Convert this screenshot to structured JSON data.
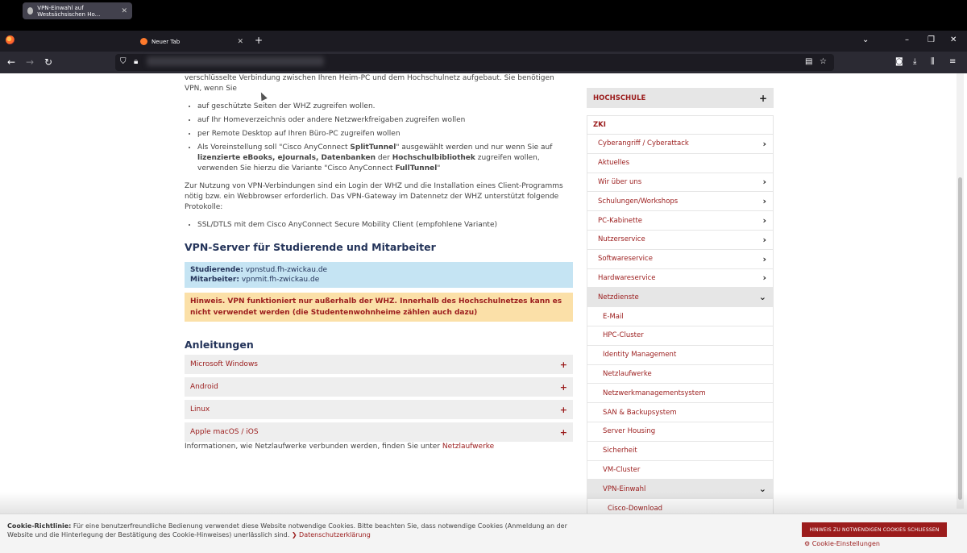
{
  "browser": {
    "tabs": [
      {
        "label": "VPN-Einwahl auf Westsächsischen Ho...",
        "active": true
      },
      {
        "label": "Neuer Tab",
        "active": false
      }
    ],
    "new_tab": "+",
    "window_controls": {
      "minimize": "–",
      "maximize": "❐",
      "close": "✕",
      "list": "⌄"
    },
    "nav": {
      "back": "←",
      "forward": "→",
      "reload": "↻"
    }
  },
  "main": {
    "intro": "verschlüsselte Verbindung zwischen Ihren Heim-PC und dem Hochschulnetz aufgebaut. Sie benötigen VPN, wenn Sie",
    "bullets": [
      "auf geschützte Seiten der WHZ zugreifen wollen.",
      "auf Ihr Homeverzeichnis oder andere Netzwerkfreigaben zugreifen wollen",
      "per Remote Desktop auf Ihren Büro-PC zugreifen wollen"
    ],
    "bullet4": {
      "t1": "Als Voreinstellung soll \"Cisco AnyConnect ",
      "b1": "SplitTunnel",
      "t2": "\" ausgewählt werden und nur wenn Sie auf ",
      "b2": "lizenzierte eBooks, eJournals, Datenbanken",
      "t3": " der ",
      "b3": "Hochschulbibliothek",
      "t4": " zugreifen wollen, verwenden Sie hierzu die Variante \"Cisco AnyConnect ",
      "b4": "FullTunnel",
      "t5": "\""
    },
    "usage": "Zur Nutzung von VPN-Verbindungen sind ein Login der WHZ und die Installation eines Client-Programms nötig bzw. ein Webbrowser erforderlich. Das VPN-Gateway im Datennetz der WHZ unterstützt folgende Protokolle:",
    "protocols": [
      "SSL/DTLS mit dem Cisco AnyConnect Secure Mobility Client (empfohlene Variante)"
    ],
    "server_heading": "VPN-Server für Studierende und Mitarbeiter",
    "servers": [
      {
        "label": "Studierende:",
        "host": "vpnstud.fh-zwickau.de"
      },
      {
        "label": "Mitarbeiter:",
        "host": "vpnmit.fh-zwickau.de"
      }
    ],
    "warning": "Hinweis. VPN funktioniert nur außerhalb der WHZ. Innerhalb des Hochschulnetzes kann es nicht verwendet werden (die Studentenwohnheime zählen auch dazu)",
    "guides_heading": "Anleitungen",
    "guides": [
      "Microsoft Windows",
      "Android",
      "Linux",
      "Apple macOS / iOS"
    ],
    "guide_icon": "+",
    "info_text": "Informationen, wie Netzlaufwerke verbunden werden, finden Sie unter ",
    "info_link": "Netzlaufwerke"
  },
  "sidebar": {
    "head": "HOCHSCHULE",
    "head_icon": "+",
    "zki": "ZKI",
    "items": [
      {
        "label": "Cyberangriff / Cyberattack",
        "arrow": "›"
      },
      {
        "label": "Aktuelles",
        "arrow": ""
      },
      {
        "label": "Wir über uns",
        "arrow": "›"
      },
      {
        "label": "Schulungen/Workshops",
        "arrow": "›"
      },
      {
        "label": "PC-Kabinette",
        "arrow": "›"
      },
      {
        "label": "Nutzerservice",
        "arrow": "›"
      },
      {
        "label": "Softwareservice",
        "arrow": "›"
      },
      {
        "label": "Hardwareservice",
        "arrow": "›"
      },
      {
        "label": "Netzdienste",
        "arrow": "⌄"
      }
    ],
    "netz_items": [
      {
        "label": "E-Mail",
        "arrow": ""
      },
      {
        "label": "HPC-Cluster",
        "arrow": ""
      },
      {
        "label": "Identity Management",
        "arrow": ""
      },
      {
        "label": "Netzlaufwerke",
        "arrow": ""
      },
      {
        "label": "Netzwerkmanagementsystem",
        "arrow": ""
      },
      {
        "label": "SAN & Backupsystem",
        "arrow": ""
      },
      {
        "label": "Server Housing",
        "arrow": ""
      },
      {
        "label": "Sicherheit",
        "arrow": ""
      },
      {
        "label": "VM-Cluster",
        "arrow": ""
      },
      {
        "label": "VPN-Einwahl",
        "arrow": "⌄"
      }
    ],
    "vpn_items": [
      {
        "label": "Cisco-Download"
      }
    ]
  },
  "cookie": {
    "title": "Cookie-Richtlinie:",
    "text": " Für eine benutzerfreundliche Bedienung verwendet diese Website notwendige Cookies. Bitte beachten Sie, dass notwendige Cookies (Anmeldung an der Website und die Hinterlegung der Bestätigung des Cookie-Hinweises) unerlässlich sind. ",
    "link": "❯ Datenschutzerklärung",
    "button": "HINWEIS ZU NOTWENDIGEN COOKIES SCHLIESSEN",
    "settings": "⚙ Cookie-Einstellungen"
  }
}
